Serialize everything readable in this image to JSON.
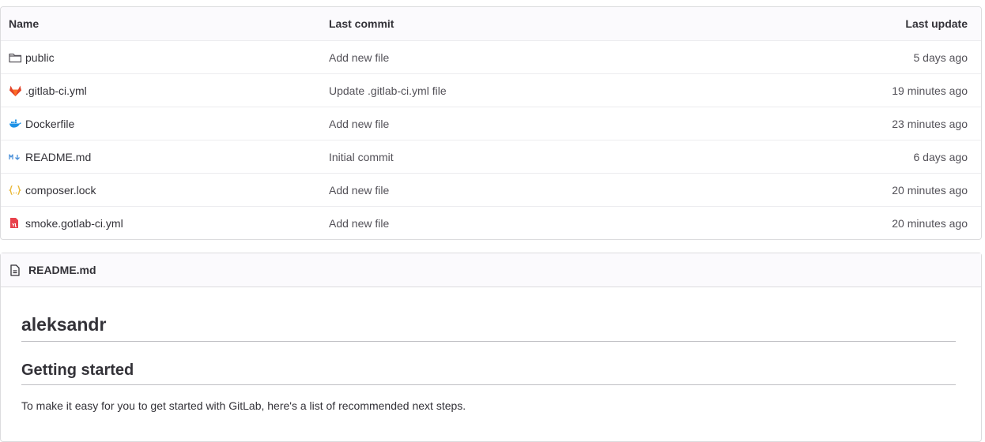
{
  "file_table": {
    "headers": {
      "name": "Name",
      "last_commit": "Last commit",
      "last_update": "Last update"
    },
    "rows": [
      {
        "icon": "folder-icon",
        "name": "public",
        "commit": "Add new file",
        "updated": "5 days ago"
      },
      {
        "icon": "gitlab-icon",
        "name": ".gitlab-ci.yml",
        "commit": "Update .gitlab-ci.yml file",
        "updated": "19 minutes ago"
      },
      {
        "icon": "docker-icon",
        "name": "Dockerfile",
        "commit": "Add new file",
        "updated": "23 minutes ago"
      },
      {
        "icon": "markdown-icon",
        "name": "README.md",
        "commit": "Initial commit",
        "updated": "6 days ago"
      },
      {
        "icon": "json-braces-icon",
        "name": "composer.lock",
        "commit": "Add new file",
        "updated": "20 minutes ago"
      },
      {
        "icon": "yaml-file-icon",
        "name": "smoke.gotlab-ci.yml",
        "commit": "Add new file",
        "updated": "20 minutes ago"
      }
    ]
  },
  "readme": {
    "icon": "document-icon",
    "filename": "README.md",
    "heading1": "aleksandr",
    "heading2": "Getting started",
    "paragraph": "To make it easy for you to get started with GitLab, here's a list of recommended next steps."
  },
  "colors": {
    "gitlab_orange": "#e24329",
    "docker_blue": "#1d91e6",
    "markdown_blue": "#4a90d9",
    "json_yellow": "#e8b32a",
    "yaml_red": "#e8414b"
  }
}
